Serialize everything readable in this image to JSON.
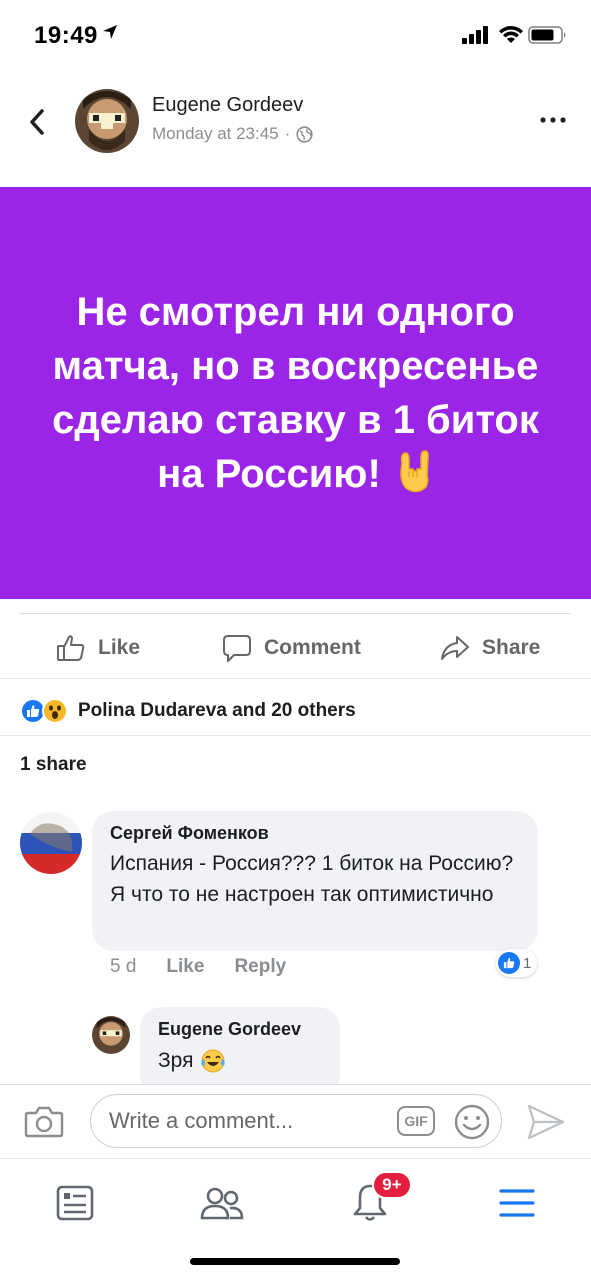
{
  "status_bar": {
    "time": "19:49",
    "icons": [
      "location-arrow-icon",
      "signal-icon",
      "wifi-icon",
      "battery-icon"
    ]
  },
  "post": {
    "author": "Eugene Gordeev",
    "timestamp": "Monday at 23:45",
    "separator": "·",
    "privacy_icon": "globe-icon",
    "background_color": "#9b25e6",
    "text": "Не смотрел ни одного матча, но в воскресенье сделаю ставку в 1 биток на Россию!",
    "emoji_icon": "rock-on-hand-emoji"
  },
  "actions": {
    "like": "Like",
    "comment": "Comment",
    "share": "Share"
  },
  "reactions": {
    "icons": [
      "like-reaction-icon",
      "wow-reaction-icon"
    ],
    "summary": "Polina Dudareva and 20 others"
  },
  "shares": {
    "label": "1 share"
  },
  "comments": [
    {
      "author": "Сергей Фоменков",
      "text": "Испания - Россия??? 1 биток на Россию? Я что то не настроен так оптимистично",
      "age": "5 d",
      "like_label": "Like",
      "reply_label": "Reply",
      "like_count": "1"
    }
  ],
  "reply": {
    "author": "Eugene Gordeev",
    "text": "Зря",
    "emoji_icon": "laughing-tears-emoji"
  },
  "composer": {
    "placeholder": "Write a comment...",
    "gif_label": "GIF"
  },
  "tab_bar": {
    "notifications_badge": "9+",
    "active_tab": "menu"
  },
  "colors": {
    "brand_blue": "#1877f2",
    "badge_red": "#e41e3f",
    "muted_text": "#8a8d91"
  }
}
